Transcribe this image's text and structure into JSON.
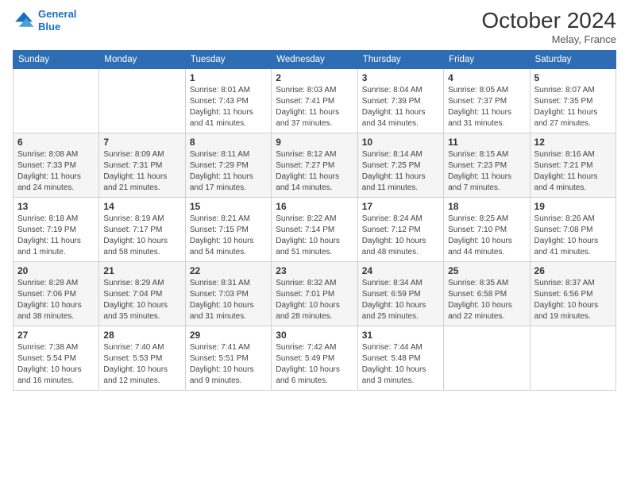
{
  "logo": {
    "line1": "General",
    "line2": "Blue"
  },
  "title": "October 2024",
  "location": "Melay, France",
  "days_of_week": [
    "Sunday",
    "Monday",
    "Tuesday",
    "Wednesday",
    "Thursday",
    "Friday",
    "Saturday"
  ],
  "weeks": [
    [
      {
        "day": "",
        "sunrise": "",
        "sunset": "",
        "daylight": ""
      },
      {
        "day": "",
        "sunrise": "",
        "sunset": "",
        "daylight": ""
      },
      {
        "day": "1",
        "sunrise": "Sunrise: 8:01 AM",
        "sunset": "Sunset: 7:43 PM",
        "daylight": "Daylight: 11 hours and 41 minutes."
      },
      {
        "day": "2",
        "sunrise": "Sunrise: 8:03 AM",
        "sunset": "Sunset: 7:41 PM",
        "daylight": "Daylight: 11 hours and 37 minutes."
      },
      {
        "day": "3",
        "sunrise": "Sunrise: 8:04 AM",
        "sunset": "Sunset: 7:39 PM",
        "daylight": "Daylight: 11 hours and 34 minutes."
      },
      {
        "day": "4",
        "sunrise": "Sunrise: 8:05 AM",
        "sunset": "Sunset: 7:37 PM",
        "daylight": "Daylight: 11 hours and 31 minutes."
      },
      {
        "day": "5",
        "sunrise": "Sunrise: 8:07 AM",
        "sunset": "Sunset: 7:35 PM",
        "daylight": "Daylight: 11 hours and 27 minutes."
      }
    ],
    [
      {
        "day": "6",
        "sunrise": "Sunrise: 8:08 AM",
        "sunset": "Sunset: 7:33 PM",
        "daylight": "Daylight: 11 hours and 24 minutes."
      },
      {
        "day": "7",
        "sunrise": "Sunrise: 8:09 AM",
        "sunset": "Sunset: 7:31 PM",
        "daylight": "Daylight: 11 hours and 21 minutes."
      },
      {
        "day": "8",
        "sunrise": "Sunrise: 8:11 AM",
        "sunset": "Sunset: 7:29 PM",
        "daylight": "Daylight: 11 hours and 17 minutes."
      },
      {
        "day": "9",
        "sunrise": "Sunrise: 8:12 AM",
        "sunset": "Sunset: 7:27 PM",
        "daylight": "Daylight: 11 hours and 14 minutes."
      },
      {
        "day": "10",
        "sunrise": "Sunrise: 8:14 AM",
        "sunset": "Sunset: 7:25 PM",
        "daylight": "Daylight: 11 hours and 11 minutes."
      },
      {
        "day": "11",
        "sunrise": "Sunrise: 8:15 AM",
        "sunset": "Sunset: 7:23 PM",
        "daylight": "Daylight: 11 hours and 7 minutes."
      },
      {
        "day": "12",
        "sunrise": "Sunrise: 8:16 AM",
        "sunset": "Sunset: 7:21 PM",
        "daylight": "Daylight: 11 hours and 4 minutes."
      }
    ],
    [
      {
        "day": "13",
        "sunrise": "Sunrise: 8:18 AM",
        "sunset": "Sunset: 7:19 PM",
        "daylight": "Daylight: 11 hours and 1 minute."
      },
      {
        "day": "14",
        "sunrise": "Sunrise: 8:19 AM",
        "sunset": "Sunset: 7:17 PM",
        "daylight": "Daylight: 10 hours and 58 minutes."
      },
      {
        "day": "15",
        "sunrise": "Sunrise: 8:21 AM",
        "sunset": "Sunset: 7:15 PM",
        "daylight": "Daylight: 10 hours and 54 minutes."
      },
      {
        "day": "16",
        "sunrise": "Sunrise: 8:22 AM",
        "sunset": "Sunset: 7:14 PM",
        "daylight": "Daylight: 10 hours and 51 minutes."
      },
      {
        "day": "17",
        "sunrise": "Sunrise: 8:24 AM",
        "sunset": "Sunset: 7:12 PM",
        "daylight": "Daylight: 10 hours and 48 minutes."
      },
      {
        "day": "18",
        "sunrise": "Sunrise: 8:25 AM",
        "sunset": "Sunset: 7:10 PM",
        "daylight": "Daylight: 10 hours and 44 minutes."
      },
      {
        "day": "19",
        "sunrise": "Sunrise: 8:26 AM",
        "sunset": "Sunset: 7:08 PM",
        "daylight": "Daylight: 10 hours and 41 minutes."
      }
    ],
    [
      {
        "day": "20",
        "sunrise": "Sunrise: 8:28 AM",
        "sunset": "Sunset: 7:06 PM",
        "daylight": "Daylight: 10 hours and 38 minutes."
      },
      {
        "day": "21",
        "sunrise": "Sunrise: 8:29 AM",
        "sunset": "Sunset: 7:04 PM",
        "daylight": "Daylight: 10 hours and 35 minutes."
      },
      {
        "day": "22",
        "sunrise": "Sunrise: 8:31 AM",
        "sunset": "Sunset: 7:03 PM",
        "daylight": "Daylight: 10 hours and 31 minutes."
      },
      {
        "day": "23",
        "sunrise": "Sunrise: 8:32 AM",
        "sunset": "Sunset: 7:01 PM",
        "daylight": "Daylight: 10 hours and 28 minutes."
      },
      {
        "day": "24",
        "sunrise": "Sunrise: 8:34 AM",
        "sunset": "Sunset: 6:59 PM",
        "daylight": "Daylight: 10 hours and 25 minutes."
      },
      {
        "day": "25",
        "sunrise": "Sunrise: 8:35 AM",
        "sunset": "Sunset: 6:58 PM",
        "daylight": "Daylight: 10 hours and 22 minutes."
      },
      {
        "day": "26",
        "sunrise": "Sunrise: 8:37 AM",
        "sunset": "Sunset: 6:56 PM",
        "daylight": "Daylight: 10 hours and 19 minutes."
      }
    ],
    [
      {
        "day": "27",
        "sunrise": "Sunrise: 7:38 AM",
        "sunset": "Sunset: 5:54 PM",
        "daylight": "Daylight: 10 hours and 16 minutes."
      },
      {
        "day": "28",
        "sunrise": "Sunrise: 7:40 AM",
        "sunset": "Sunset: 5:53 PM",
        "daylight": "Daylight: 10 hours and 12 minutes."
      },
      {
        "day": "29",
        "sunrise": "Sunrise: 7:41 AM",
        "sunset": "Sunset: 5:51 PM",
        "daylight": "Daylight: 10 hours and 9 minutes."
      },
      {
        "day": "30",
        "sunrise": "Sunrise: 7:42 AM",
        "sunset": "Sunset: 5:49 PM",
        "daylight": "Daylight: 10 hours and 6 minutes."
      },
      {
        "day": "31",
        "sunrise": "Sunrise: 7:44 AM",
        "sunset": "Sunset: 5:48 PM",
        "daylight": "Daylight: 10 hours and 3 minutes."
      },
      {
        "day": "",
        "sunrise": "",
        "sunset": "",
        "daylight": ""
      },
      {
        "day": "",
        "sunrise": "",
        "sunset": "",
        "daylight": ""
      }
    ]
  ]
}
